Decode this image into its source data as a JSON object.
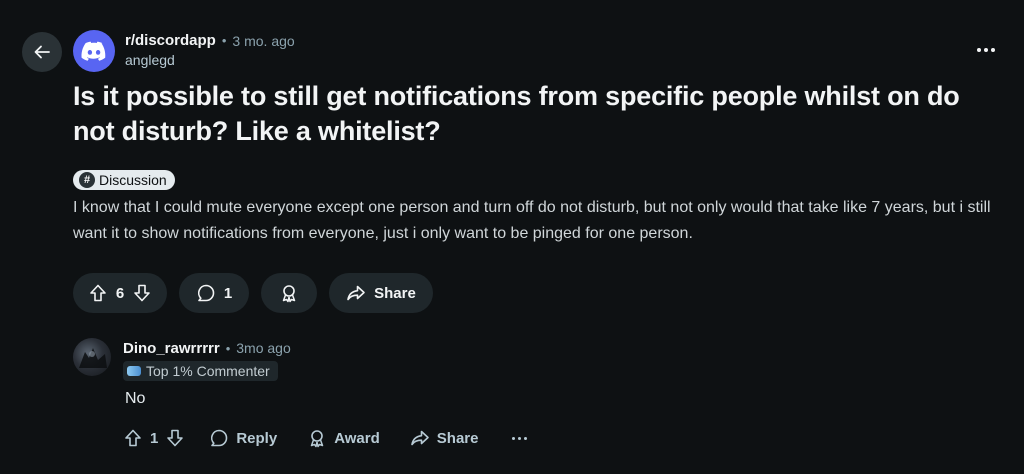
{
  "post": {
    "subreddit": "r/discordapp",
    "separator": "•",
    "time": "3 mo. ago",
    "author": "anglegd",
    "title": "Is it possible to still get notifications from specific people whilst on do not disturb? Like a whitelist?",
    "flair": {
      "icon": "#",
      "label": "Discussion"
    },
    "body": "I know that I could mute everyone except one person and turn off do not disturb, but not only would that take like 7 years, but i still want it to show notifications from everyone, just i only want to be pinged for one person.",
    "votes": "6",
    "comments": "1",
    "share_label": "Share"
  },
  "comment": {
    "user": "Dino_rawrrrrr",
    "separator": "•",
    "time": "3mo ago",
    "badge": "Top 1% Commenter",
    "body": "No",
    "votes": "1",
    "reply_label": "Reply",
    "award_label": "Award",
    "share_label": "Share"
  },
  "colors": {
    "background": "#0e1113",
    "brand_discord": "#5865f2",
    "pill": "#1f272b"
  },
  "icons": {
    "back": "arrow-left-icon",
    "subreddit": "discord-logo-icon",
    "more": "ellipsis-icon",
    "upvote": "arrow-up-icon",
    "downvote": "arrow-down-icon",
    "comment": "speech-bubble-icon",
    "award": "award-icon",
    "share": "share-arrow-icon"
  }
}
